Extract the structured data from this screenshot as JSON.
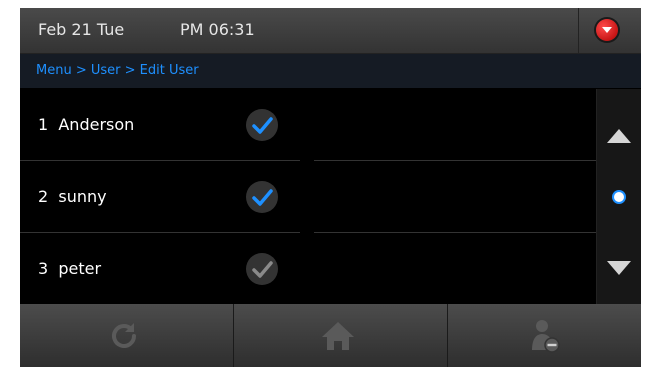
{
  "status": {
    "date": "Feb 21 Tue",
    "time": "PM 06:31",
    "dropdown_icon": "chevron-down-icon"
  },
  "breadcrumb": "Menu > User > Edit User",
  "users": [
    {
      "number": "1",
      "name": "Anderson",
      "selected": true
    },
    {
      "number": "2",
      "name": "sunny",
      "selected": true
    },
    {
      "number": "3",
      "name": "peter",
      "selected": false
    }
  ],
  "scroll": {
    "up_icon": "arrow-up-icon",
    "down_icon": "arrow-down-icon",
    "position_icon": "scroll-position-dot-icon"
  },
  "bottom_bar": {
    "buttons": [
      {
        "icon": "refresh-icon"
      },
      {
        "icon": "home-icon"
      },
      {
        "icon": "delete-user-icon"
      }
    ]
  },
  "colors": {
    "accent": "#1e90ff",
    "check_selected": "#1e90ff",
    "check_unselected": "#8a8a8a",
    "dropdown": "#d40000"
  }
}
